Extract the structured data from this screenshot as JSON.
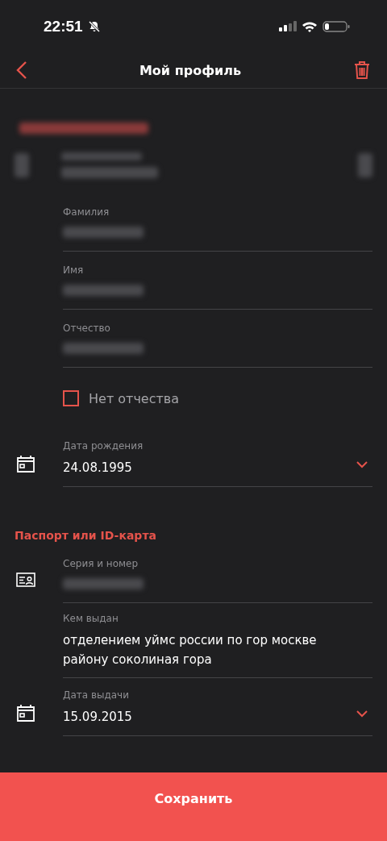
{
  "status_bar": {
    "time": "22:51"
  },
  "header": {
    "title": "Мой профиль"
  },
  "sections": [
    {
      "title_blurred": true,
      "fields": [
        {
          "kind": "redacted"
        },
        {
          "kind": "text",
          "label": "Фамилия",
          "blurred": true
        },
        {
          "kind": "text",
          "label": "Имя",
          "blurred": true
        },
        {
          "kind": "text",
          "label": "Отчество",
          "blurred": true
        },
        {
          "kind": "checkbox",
          "label": "Нет отчества",
          "checked": false
        },
        {
          "kind": "date",
          "label": "Дата рождения",
          "value": "24.08.1995"
        }
      ]
    },
    {
      "title": "Паспорт или ID-карта",
      "title_blurred": false,
      "fields": [
        {
          "kind": "document",
          "label": "Серия и номер",
          "blurred": true
        },
        {
          "kind": "text",
          "label": "Кем выдан",
          "value": "отделением уймс россии по гор москве району соколиная гора",
          "blurred": false
        },
        {
          "kind": "date",
          "label": "Дата выдачи",
          "value": "15.09.2015"
        }
      ]
    }
  ],
  "save_button": "Сохранить"
}
